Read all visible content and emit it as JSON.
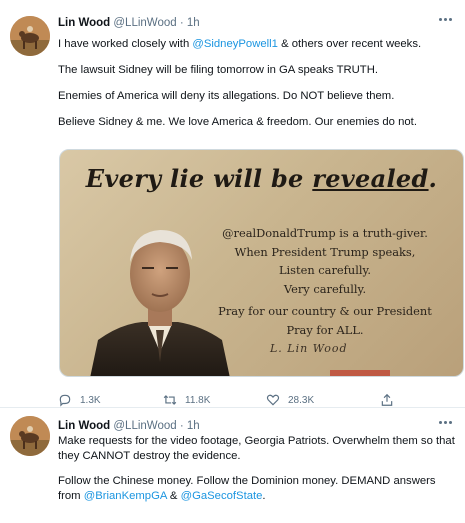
{
  "tweets": [
    {
      "author": {
        "name": "Lin Wood",
        "handle": "@LLinWood",
        "separator": "·",
        "time": "1h"
      },
      "paragraphs": [
        {
          "before": "I have worked closely with ",
          "mention": "@SidneyPowell1",
          "after": " & others over recent weeks."
        },
        {
          "text": "The lawsuit Sidney will be filing tomorrow in GA speaks TRUTH."
        },
        {
          "text": "Enemies of America will deny its allegations. Do NOT believe them."
        },
        {
          "text": "Believe Sidney & me. We love America & freedom. Our enemies do not."
        }
      ],
      "media": {
        "title_pre": "Every lie will be ",
        "title_emph": "revealed",
        "title_post": ".",
        "quote_lines_1": [
          "@realDonaldTrump is a truth-giver.",
          "When President Trump speaks,",
          "Listen carefully.",
          "Very carefully."
        ],
        "quote_lines_2": [
          "Pray for our country & our President",
          "Pray for ALL."
        ],
        "signature": "L. Lin Wood"
      },
      "actions": {
        "replies": "1.3K",
        "retweets": "11.8K",
        "likes": "28.3K"
      }
    },
    {
      "author": {
        "name": "Lin Wood",
        "handle": "@LLinWood",
        "separator": "·",
        "time": "1h"
      },
      "paragraphs": [
        {
          "text": "Make requests for the video footage, Georgia Patriots. Overwhelm them so that they CANNOT destroy the evidence."
        },
        {
          "before": "Follow the Chinese money. Follow the Dominion money. DEMAND answers from ",
          "mention": "@BrianKempGA",
          "middle": " & ",
          "mention2": "@GaSecofState",
          "after": "."
        }
      ]
    }
  ],
  "icons": {
    "reply": "reply-icon",
    "retweet": "retweet-icon",
    "like": "heart-icon",
    "share": "share-icon",
    "more": "more-icon"
  },
  "colors": {
    "mention": "#1b95e0",
    "muted": "#5b7083",
    "text": "#0f1419"
  }
}
